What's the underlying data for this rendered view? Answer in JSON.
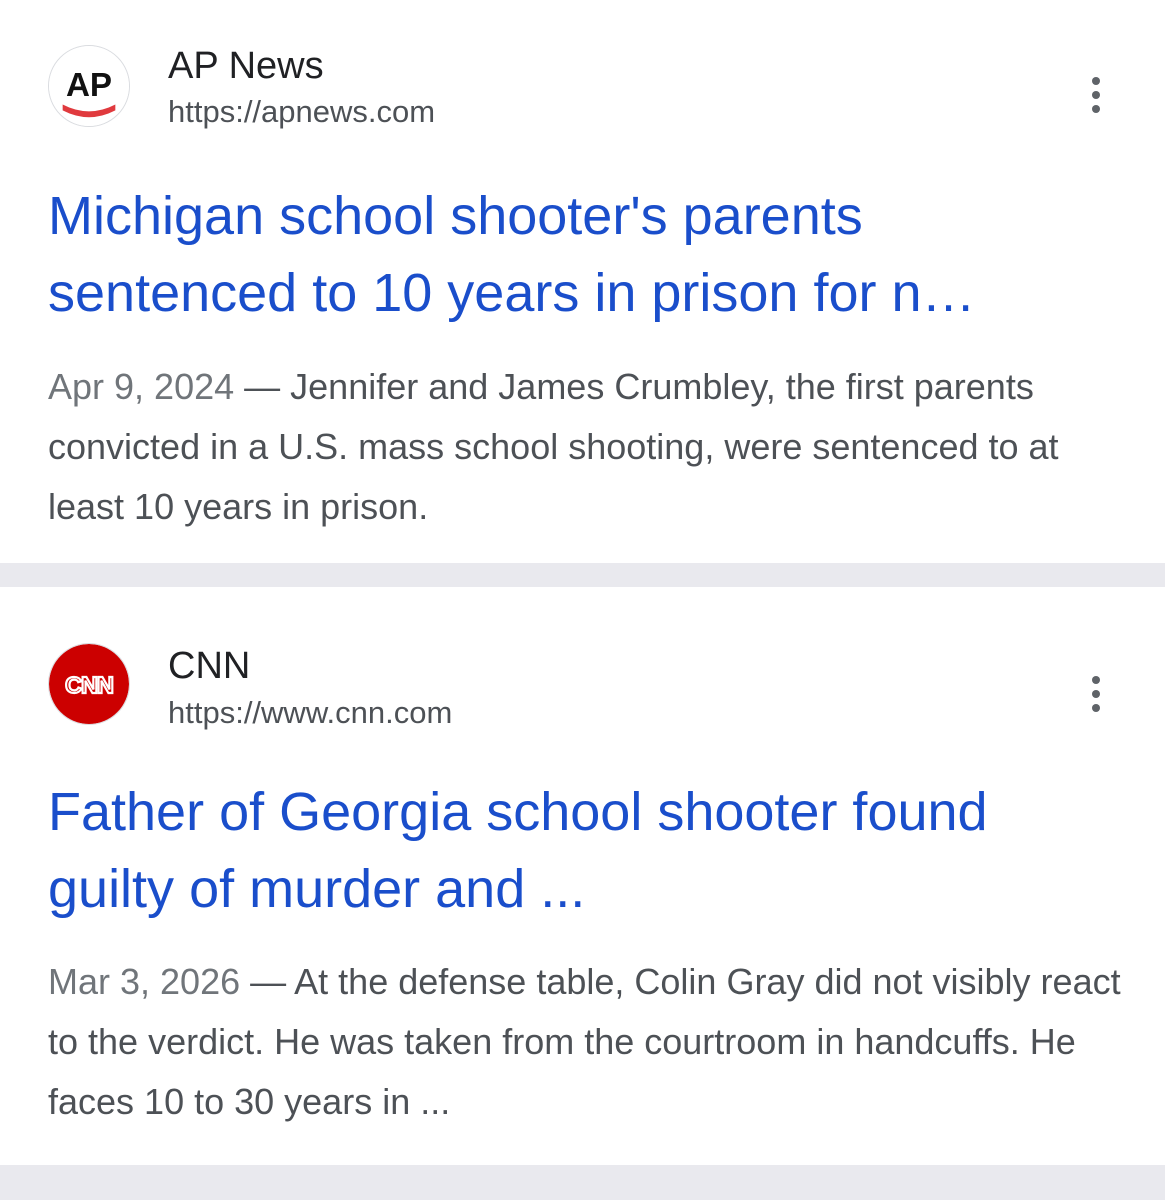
{
  "results": [
    {
      "source_name": "AP News",
      "source_url": "https://apnews.com",
      "favicon_text": "AP",
      "favicon_icon": "ap-logo-icon",
      "title_line1": "Michigan school shooter's parents",
      "title_line2": "sentenced to 10 years in prison for n…",
      "date": "Apr 9, 2024",
      "separator": " — ",
      "snippet": "Jennifer and James Crumbley, the first parents convicted in a U.S. mass school shooting, were sentenced to at least 10 years in prison."
    },
    {
      "source_name": "CNN",
      "source_url": "https://www.cnn.com",
      "favicon_text": "CNN",
      "favicon_icon": "cnn-logo-icon",
      "title_line1": "Father of Georgia school shooter found",
      "title_line2": "guilty of murder and ...",
      "date": "Mar 3, 2026",
      "separator": " — ",
      "snippet": "At the defense table, Colin Gray did not visibly react to the verdict. He was taken from the courtroom in handcuffs. He faces 10 to 30 years in ..."
    }
  ],
  "colors": {
    "title_link": "#1a4ecb",
    "snippet_text": "#4d5156",
    "divider": "#e9e9ee",
    "cnn_red": "#cc0000",
    "ap_red": "#e03a3e"
  }
}
